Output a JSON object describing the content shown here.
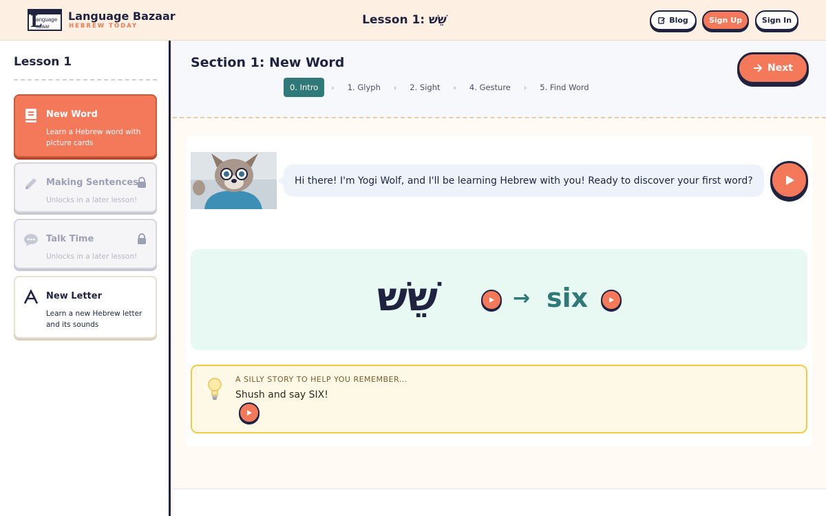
{
  "header": {
    "logo_text_1": "anguage",
    "logo_text_2": "azaar",
    "brand_name": "Language Bazaar",
    "brand_tagline": "HEBREW TODAY",
    "page_title": "Lesson 1: שֵׁשׁ",
    "blog_label": "Blog",
    "signup_label": "Sign Up",
    "signin_label": "Sign In"
  },
  "sidebar": {
    "title": "Lesson 1",
    "cards": [
      {
        "title": "New Word",
        "desc": "Learn a Hebrew word with picture cards",
        "icon": "book-icon",
        "state": "active"
      },
      {
        "title": "Making Sentences",
        "desc": "Unlocks in a later lesson!",
        "icon": "pencil-icon",
        "state": "locked"
      },
      {
        "title": "Talk Time",
        "desc": "Unlocks in a later lesson!",
        "icon": "chat-icon",
        "state": "locked"
      },
      {
        "title": "New Letter",
        "desc": "Learn a new Hebrew letter and its sounds",
        "icon": "letter-a-icon",
        "state": "available"
      }
    ]
  },
  "main": {
    "section_title": "Section 1: New Word",
    "steps": [
      "0. Intro",
      "1. Glyph",
      "2. Sight",
      "4. Gesture",
      "5. Find Word"
    ],
    "active_step": 0,
    "next_label": "Next",
    "intro_message": "Hi there! I'm Yogi Wolf, and I'll be learning Hebrew with you! Ready to discover your first word?",
    "hebrew_word": "שֵׁשׁ",
    "english_word": "six",
    "story_label": "A SILLY STORY TO HELP YOU REMEMBER...",
    "story_text": "Shush and say SIX!"
  },
  "colors": {
    "accent": "#f3795a",
    "teal": "#2f7a78",
    "navy": "#1f2340",
    "story_border": "#f0cc44"
  }
}
